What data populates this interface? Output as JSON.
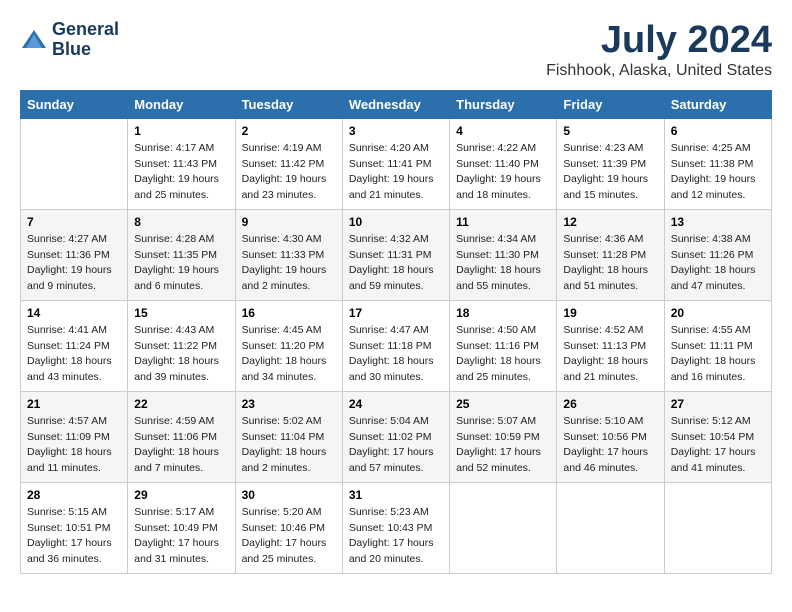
{
  "header": {
    "logo_line1": "General",
    "logo_line2": "Blue",
    "title": "July 2024",
    "subtitle": "Fishhook, Alaska, United States"
  },
  "columns": [
    "Sunday",
    "Monday",
    "Tuesday",
    "Wednesday",
    "Thursday",
    "Friday",
    "Saturday"
  ],
  "weeks": [
    [
      {
        "day": "",
        "info": ""
      },
      {
        "day": "1",
        "info": "Sunrise: 4:17 AM\nSunset: 11:43 PM\nDaylight: 19 hours\nand 25 minutes."
      },
      {
        "day": "2",
        "info": "Sunrise: 4:19 AM\nSunset: 11:42 PM\nDaylight: 19 hours\nand 23 minutes."
      },
      {
        "day": "3",
        "info": "Sunrise: 4:20 AM\nSunset: 11:41 PM\nDaylight: 19 hours\nand 21 minutes."
      },
      {
        "day": "4",
        "info": "Sunrise: 4:22 AM\nSunset: 11:40 PM\nDaylight: 19 hours\nand 18 minutes."
      },
      {
        "day": "5",
        "info": "Sunrise: 4:23 AM\nSunset: 11:39 PM\nDaylight: 19 hours\nand 15 minutes."
      },
      {
        "day": "6",
        "info": "Sunrise: 4:25 AM\nSunset: 11:38 PM\nDaylight: 19 hours\nand 12 minutes."
      }
    ],
    [
      {
        "day": "7",
        "info": "Sunrise: 4:27 AM\nSunset: 11:36 PM\nDaylight: 19 hours\nand 9 minutes."
      },
      {
        "day": "8",
        "info": "Sunrise: 4:28 AM\nSunset: 11:35 PM\nDaylight: 19 hours\nand 6 minutes."
      },
      {
        "day": "9",
        "info": "Sunrise: 4:30 AM\nSunset: 11:33 PM\nDaylight: 19 hours\nand 2 minutes."
      },
      {
        "day": "10",
        "info": "Sunrise: 4:32 AM\nSunset: 11:31 PM\nDaylight: 18 hours\nand 59 minutes."
      },
      {
        "day": "11",
        "info": "Sunrise: 4:34 AM\nSunset: 11:30 PM\nDaylight: 18 hours\nand 55 minutes."
      },
      {
        "day": "12",
        "info": "Sunrise: 4:36 AM\nSunset: 11:28 PM\nDaylight: 18 hours\nand 51 minutes."
      },
      {
        "day": "13",
        "info": "Sunrise: 4:38 AM\nSunset: 11:26 PM\nDaylight: 18 hours\nand 47 minutes."
      }
    ],
    [
      {
        "day": "14",
        "info": "Sunrise: 4:41 AM\nSunset: 11:24 PM\nDaylight: 18 hours\nand 43 minutes."
      },
      {
        "day": "15",
        "info": "Sunrise: 4:43 AM\nSunset: 11:22 PM\nDaylight: 18 hours\nand 39 minutes."
      },
      {
        "day": "16",
        "info": "Sunrise: 4:45 AM\nSunset: 11:20 PM\nDaylight: 18 hours\nand 34 minutes."
      },
      {
        "day": "17",
        "info": "Sunrise: 4:47 AM\nSunset: 11:18 PM\nDaylight: 18 hours\nand 30 minutes."
      },
      {
        "day": "18",
        "info": "Sunrise: 4:50 AM\nSunset: 11:16 PM\nDaylight: 18 hours\nand 25 minutes."
      },
      {
        "day": "19",
        "info": "Sunrise: 4:52 AM\nSunset: 11:13 PM\nDaylight: 18 hours\nand 21 minutes."
      },
      {
        "day": "20",
        "info": "Sunrise: 4:55 AM\nSunset: 11:11 PM\nDaylight: 18 hours\nand 16 minutes."
      }
    ],
    [
      {
        "day": "21",
        "info": "Sunrise: 4:57 AM\nSunset: 11:09 PM\nDaylight: 18 hours\nand 11 minutes."
      },
      {
        "day": "22",
        "info": "Sunrise: 4:59 AM\nSunset: 11:06 PM\nDaylight: 18 hours\nand 7 minutes."
      },
      {
        "day": "23",
        "info": "Sunrise: 5:02 AM\nSunset: 11:04 PM\nDaylight: 18 hours\nand 2 minutes."
      },
      {
        "day": "24",
        "info": "Sunrise: 5:04 AM\nSunset: 11:02 PM\nDaylight: 17 hours\nand 57 minutes."
      },
      {
        "day": "25",
        "info": "Sunrise: 5:07 AM\nSunset: 10:59 PM\nDaylight: 17 hours\nand 52 minutes."
      },
      {
        "day": "26",
        "info": "Sunrise: 5:10 AM\nSunset: 10:56 PM\nDaylight: 17 hours\nand 46 minutes."
      },
      {
        "day": "27",
        "info": "Sunrise: 5:12 AM\nSunset: 10:54 PM\nDaylight: 17 hours\nand 41 minutes."
      }
    ],
    [
      {
        "day": "28",
        "info": "Sunrise: 5:15 AM\nSunset: 10:51 PM\nDaylight: 17 hours\nand 36 minutes."
      },
      {
        "day": "29",
        "info": "Sunrise: 5:17 AM\nSunset: 10:49 PM\nDaylight: 17 hours\nand 31 minutes."
      },
      {
        "day": "30",
        "info": "Sunrise: 5:20 AM\nSunset: 10:46 PM\nDaylight: 17 hours\nand 25 minutes."
      },
      {
        "day": "31",
        "info": "Sunrise: 5:23 AM\nSunset: 10:43 PM\nDaylight: 17 hours\nand 20 minutes."
      },
      {
        "day": "",
        "info": ""
      },
      {
        "day": "",
        "info": ""
      },
      {
        "day": "",
        "info": ""
      }
    ]
  ]
}
